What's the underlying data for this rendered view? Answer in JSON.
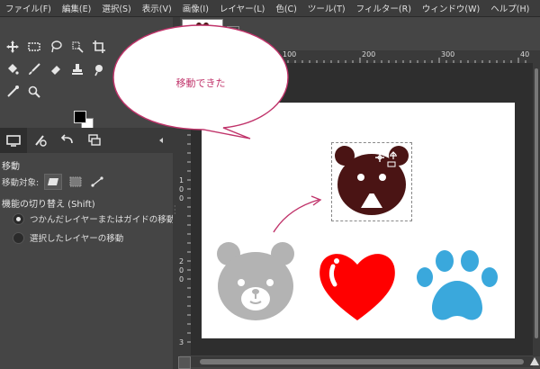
{
  "menubar": {
    "items": [
      "ファイル(F)",
      "編集(E)",
      "選択(S)",
      "表示(V)",
      "画像(I)",
      "レイヤー(L)",
      "色(C)",
      "ツール(T)",
      "フィルター(R)",
      "ウィンドウ(W)",
      "ヘルプ(H)"
    ]
  },
  "toolbox": {
    "tools_row1": [
      "move-icon",
      "rect-select-icon",
      "lasso-icon",
      "fuzzy-select-icon",
      "crop-icon"
    ],
    "tools_row2": [
      "bucket-fill-icon",
      "paintbrush-icon",
      "eraser-icon",
      "clone-icon",
      "smudge-icon"
    ],
    "tools_row3": [
      "color-picker-icon",
      "zoom-icon"
    ],
    "colors": {
      "foreground": "#000000",
      "background": "#ffffff"
    }
  },
  "tabs": [
    "tool-options-icon",
    "device-status-icon",
    "undo-history-icon",
    "images-icon"
  ],
  "tool_options": {
    "title": "移動",
    "target_label": "移動対象:",
    "toggle_title": "機能の切り替え  (Shift)",
    "options": [
      {
        "label": "つかんだレイヤーまたはガイドの移動",
        "selected": true
      },
      {
        "label": "選択したレイヤーの移動",
        "selected": false
      }
    ]
  },
  "rulers": {
    "top": [
      "100",
      "200",
      "300",
      "40"
    ],
    "left": [
      "1",
      "0",
      "0",
      "2",
      "0",
      "0",
      "3"
    ]
  },
  "callout": {
    "text": "移動できた"
  },
  "colors": {
    "accent": "#c0336a",
    "bear_dark": "#4a1414",
    "bear_gray": "#b3b3b3",
    "heart_red": "#ff0000",
    "paw_blue": "#3aa8dc"
  }
}
